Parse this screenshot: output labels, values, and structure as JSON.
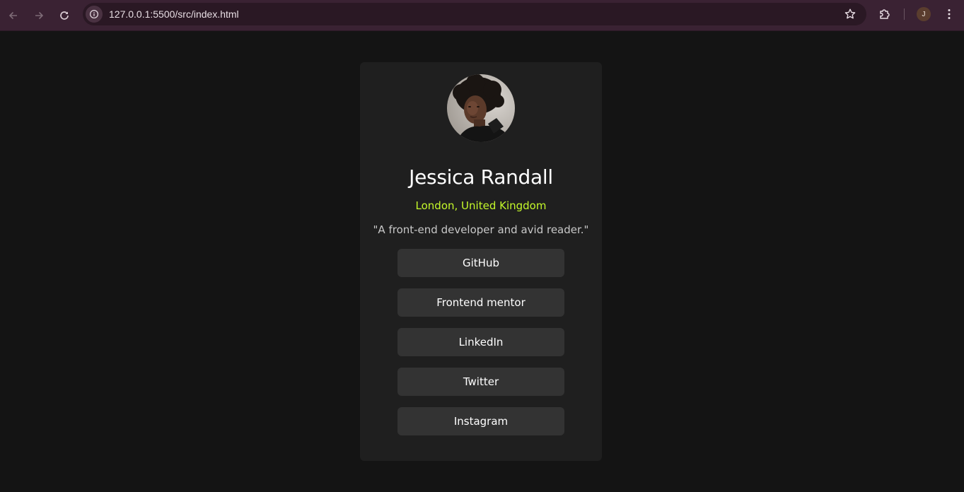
{
  "browser": {
    "url": "127.0.0.1:5500/src/index.html",
    "profile_initial": "J",
    "theme_color": "#3a2233"
  },
  "profile": {
    "name": "Jessica Randall",
    "location": "London, United Kingdom",
    "bio": "\"A front-end developer and avid reader.\"",
    "accent_color": "#c4f82a"
  },
  "links": [
    {
      "label": "GitHub"
    },
    {
      "label": "Frontend mentor"
    },
    {
      "label": "LinkedIn"
    },
    {
      "label": "Twitter"
    },
    {
      "label": "Instagram"
    }
  ]
}
